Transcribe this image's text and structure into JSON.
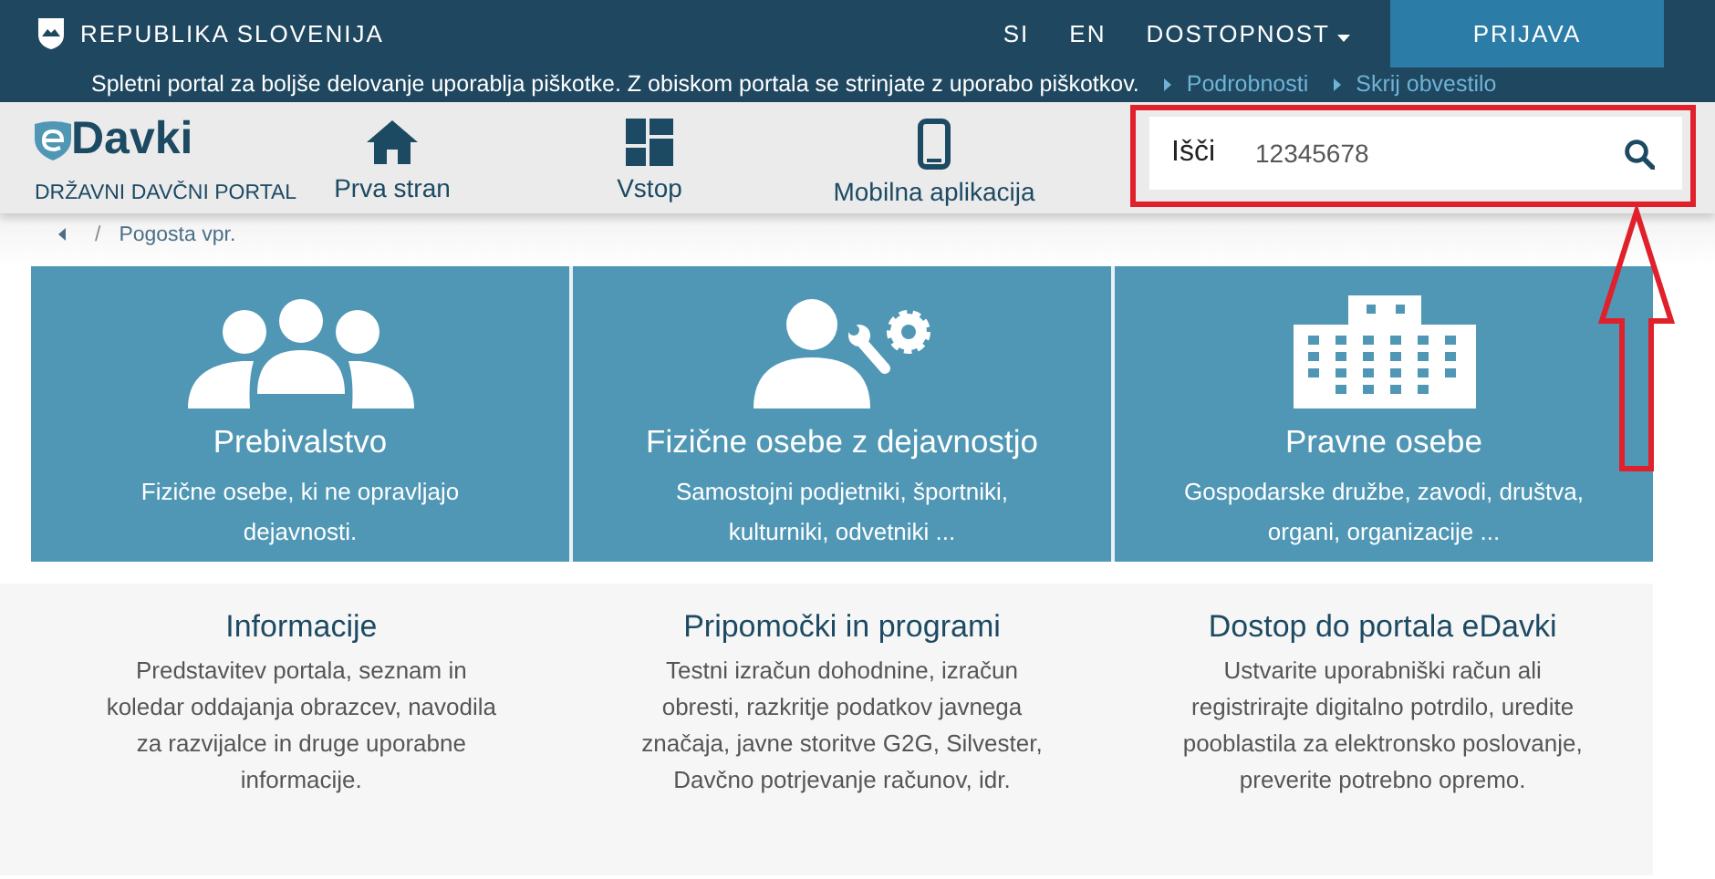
{
  "top_bar": {
    "title": "REPUBLIKA SLOVENIJA",
    "links": [
      "SI",
      "EN"
    ],
    "accessibility": "DOSTOPNOST",
    "login": "PRIJAVA"
  },
  "cookie_notice": {
    "text": "Spletni portal za boljše delovanje uporablja piškotke. Z obiskom portala se strinjate z uporabo piškotkov.",
    "links": [
      "Podrobnosti",
      "Skrij obvestilo"
    ]
  },
  "logo": {
    "name": "Davki",
    "subtitle": "DRŽAVNI DAVČNI PORTAL"
  },
  "nav": [
    {
      "kind": "home",
      "label": "Prva stran"
    },
    {
      "kind": "grid",
      "label": "Vstop"
    },
    {
      "kind": "phone",
      "label": "Mobilna aplikacija"
    }
  ],
  "search": {
    "label": "Išči",
    "value": "12345678"
  },
  "breadcrumb": {
    "separator": "/",
    "current": "Pogosta vpr."
  },
  "tiles": [
    {
      "kind": "people",
      "title": "Prebivalstvo",
      "text": "Fizične osebe, ki ne opravljajo dejavnosti."
    },
    {
      "kind": "worker",
      "title": "Fizične osebe z dejavnostjo",
      "text": "Samostojni podjetniki, športniki, kulturniki, odvetniki ..."
    },
    {
      "kind": "building",
      "title": "Pravne osebe",
      "text": "Gospodarske družbe, zavodi, društva, organi, organizacije ..."
    }
  ],
  "info": [
    {
      "title": "Informacije",
      "text": "Predstavitev portala, seznam in koledar oddajanja obrazcev, navodila za razvijalce in druge uporabne informacije."
    },
    {
      "title": "Pripomočki in programi",
      "text": "Testni izračun dohodnine, izračun obresti, razkritje podatkov javnega značaja, javne storitve G2G, Silvester, Davčno potrjevanje računov, idr."
    },
    {
      "title": "Dostop do portala eDavki",
      "text": "Ustvarite uporabniški račun ali registrirajte digitalno potrdilo, uredite pooblastila za elektronsko poslovanje, preverite potrebno opremo."
    }
  ]
}
